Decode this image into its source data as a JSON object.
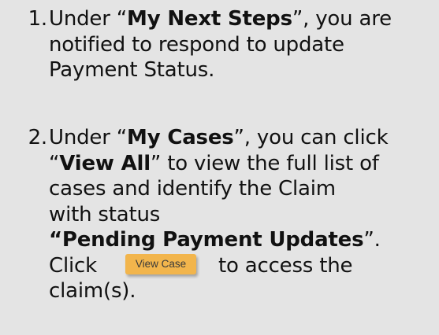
{
  "steps": [
    {
      "number": "1.",
      "line1_prefix": "Under “",
      "line1_bold": "My Next Steps",
      "line1_suffix": "”, you are",
      "line2": "notified to respond to update",
      "line3": "Payment Status."
    },
    {
      "number": "2.",
      "line1_prefix": "Under “",
      "line1_bold": "My Cases",
      "line1_suffix": "”, you can click",
      "line2_prefix": "“",
      "line2_bold": "View All",
      "line2_suffix": "” to view the full list of",
      "line3": "cases and identify the Claim",
      "line4": "with status",
      "line5_bold": "“Pending Payment Updates",
      "line5_suffix": "”.",
      "line6_prefix": "Click",
      "button_label": "View Case",
      "line6_suffix": "to access the",
      "line7": "claim(s)."
    }
  ]
}
